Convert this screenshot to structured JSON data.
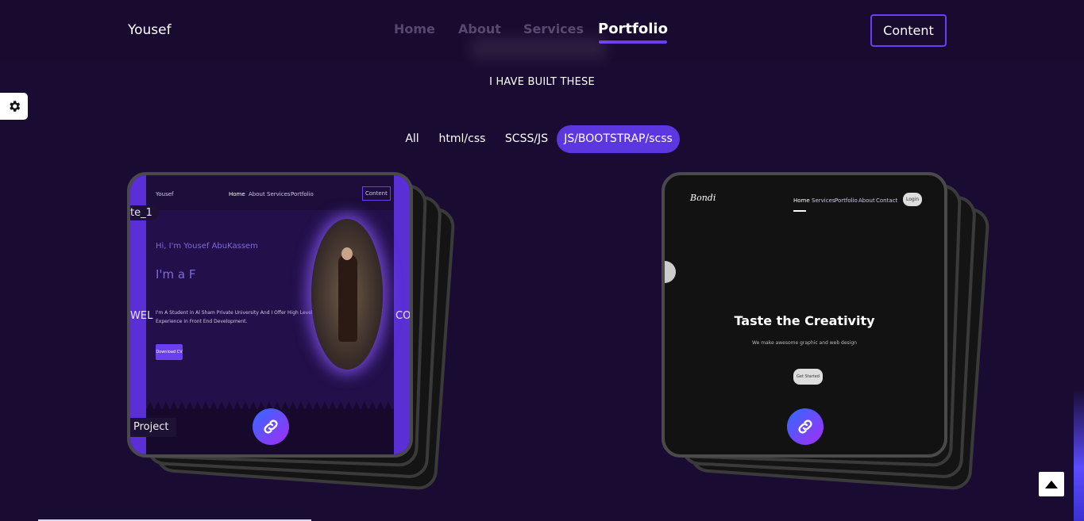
{
  "header": {
    "brand": "Yousef",
    "nav": [
      {
        "label": "Home",
        "active": false
      },
      {
        "label": "About",
        "active": false
      },
      {
        "label": "Services",
        "active": false
      },
      {
        "label": "Portfolio",
        "active": true
      }
    ],
    "content_button": "Content"
  },
  "section": {
    "subtitle": "I HAVE BUILT THESE"
  },
  "filters": [
    {
      "label": "All",
      "active": false
    },
    {
      "label": "html/css",
      "active": false
    },
    {
      "label": "SCSS/JS",
      "active": false
    },
    {
      "label": "JS/BOOTSTRAP/scss",
      "active": true
    }
  ],
  "projects": [
    {
      "overlay_title": "te_1",
      "overlay_side_left": "WEL",
      "overlay_side_right": "COM",
      "tag": "Project",
      "preview": {
        "brand": "Yousef",
        "nav": [
          "Home",
          "About",
          "Services",
          "Portfolio"
        ],
        "button": "Content",
        "greeting": "Hi, I'm Yousef AbuKassem",
        "typed": "I'm a F",
        "bio": "I'm A Student in Al Sham Private University And I Offer High Level Experience in Front End Development.",
        "cta": "Download CV"
      }
    },
    {
      "preview": {
        "brand": "Bondi",
        "nav": [
          "Home",
          "Services",
          "Portfolio",
          "About",
          "Contact"
        ],
        "login": "Login",
        "headline": "Taste the Creativity",
        "tagline": "We make awesome graphic and web design",
        "cta": "Get Started"
      }
    }
  ],
  "icons": {
    "settings": "gear-icon",
    "link": "link-icon",
    "scroll_top": "caret-up-icon"
  },
  "colors": {
    "background": "#1a0b33",
    "accent": "#5b37e0",
    "link_gradient_start": "#2f6bff",
    "link_gradient_end": "#a52df5"
  }
}
